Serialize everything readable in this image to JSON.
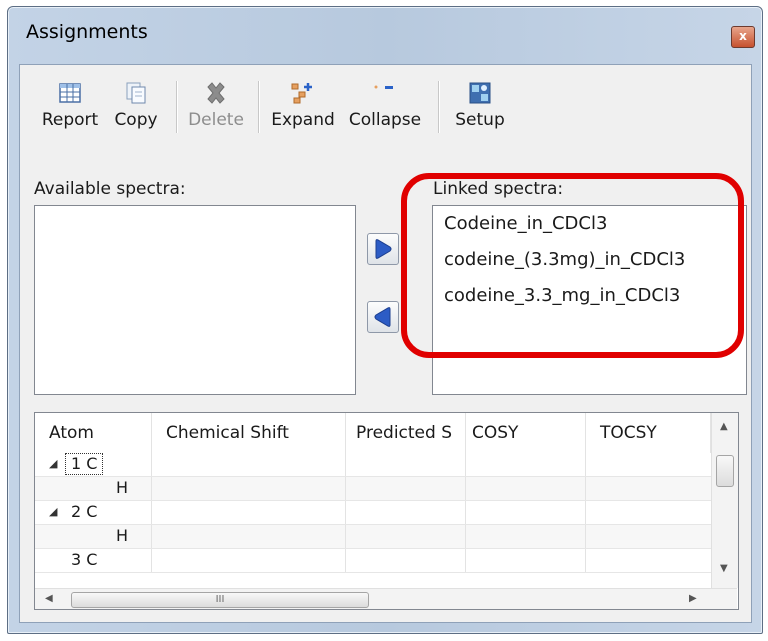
{
  "window": {
    "title": "Assignments",
    "close_glyph": "x"
  },
  "toolbar": {
    "buttons": [
      {
        "label": "Report",
        "icon": "report-grid-icon",
        "enabled": true
      },
      {
        "label": "Copy",
        "icon": "copy-icon",
        "enabled": true
      },
      {
        "label": "Delete",
        "icon": "delete-x-icon",
        "enabled": false
      },
      {
        "label": "Expand",
        "icon": "expand-tree-icon",
        "enabled": true
      },
      {
        "label": "Collapse",
        "icon": "collapse-icon",
        "enabled": true
      },
      {
        "label": "Setup",
        "icon": "setup-icon",
        "enabled": true
      }
    ]
  },
  "available": {
    "label": "Available spectra:",
    "items": []
  },
  "linked": {
    "label": "Linked spectra:",
    "items": [
      "Codeine_in_CDCl3",
      "codeine_(3.3mg)_in_CDCl3",
      "codeine_3.3_mg_in_CDCl3"
    ]
  },
  "table": {
    "columns": [
      "Atom",
      "Chemical Shift",
      "Predicted S",
      "COSY",
      "TOCSY"
    ],
    "rows": [
      {
        "atom": "1 C",
        "expander": "expanded",
        "selected": true
      },
      {
        "atom": "H"
      },
      {
        "atom": "2 C",
        "expander": "expanded"
      },
      {
        "atom": "H"
      },
      {
        "atom": "3 C"
      }
    ],
    "hscroll_grip": "III"
  },
  "colors": {
    "highlight": "#e00000",
    "window_frame": "#b7c9de"
  }
}
